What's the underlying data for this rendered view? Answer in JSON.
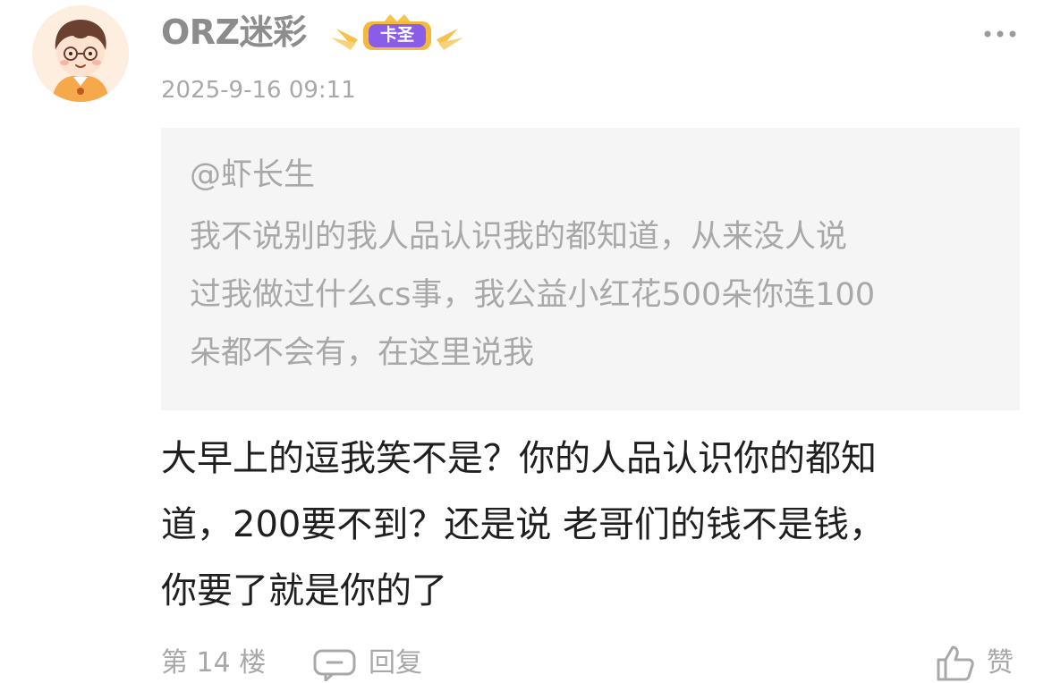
{
  "comment": {
    "username": "ORZ迷彩",
    "badge_label": "卡圣",
    "timestamp": "2025-9-16 09:11",
    "quote": {
      "author": "@虾长生",
      "text": "我不说别的我人品认识我的都知道，从来没人说\n过我做过什么cs事，我公益小红花500朵你连100\n朵都不会有，在这里说我"
    },
    "reply": "大早上的逗我笑不是？你的人品认识你的都知\n道，200要不到？还是说 老哥们的钱不是钱，\n你要了就是你的了",
    "footer": {
      "floor_label": "第 14 楼",
      "reply_label": "回复",
      "like_label": "赞"
    }
  },
  "icons": {
    "avatar": "avatar-cartoon-boy-glasses",
    "badge": "crown-badge",
    "more": "more-dots-icon",
    "reply": "comment-bubble-icon",
    "like": "thumbs-up-icon"
  },
  "colors": {
    "username": "#8c8c8c",
    "muted_text": "#a8a8a8",
    "body_text": "#1f1f1f",
    "quote_bg": "#f5f5f5",
    "badge_purple": "#8a5ce8",
    "badge_gold": "#f5c24a"
  }
}
